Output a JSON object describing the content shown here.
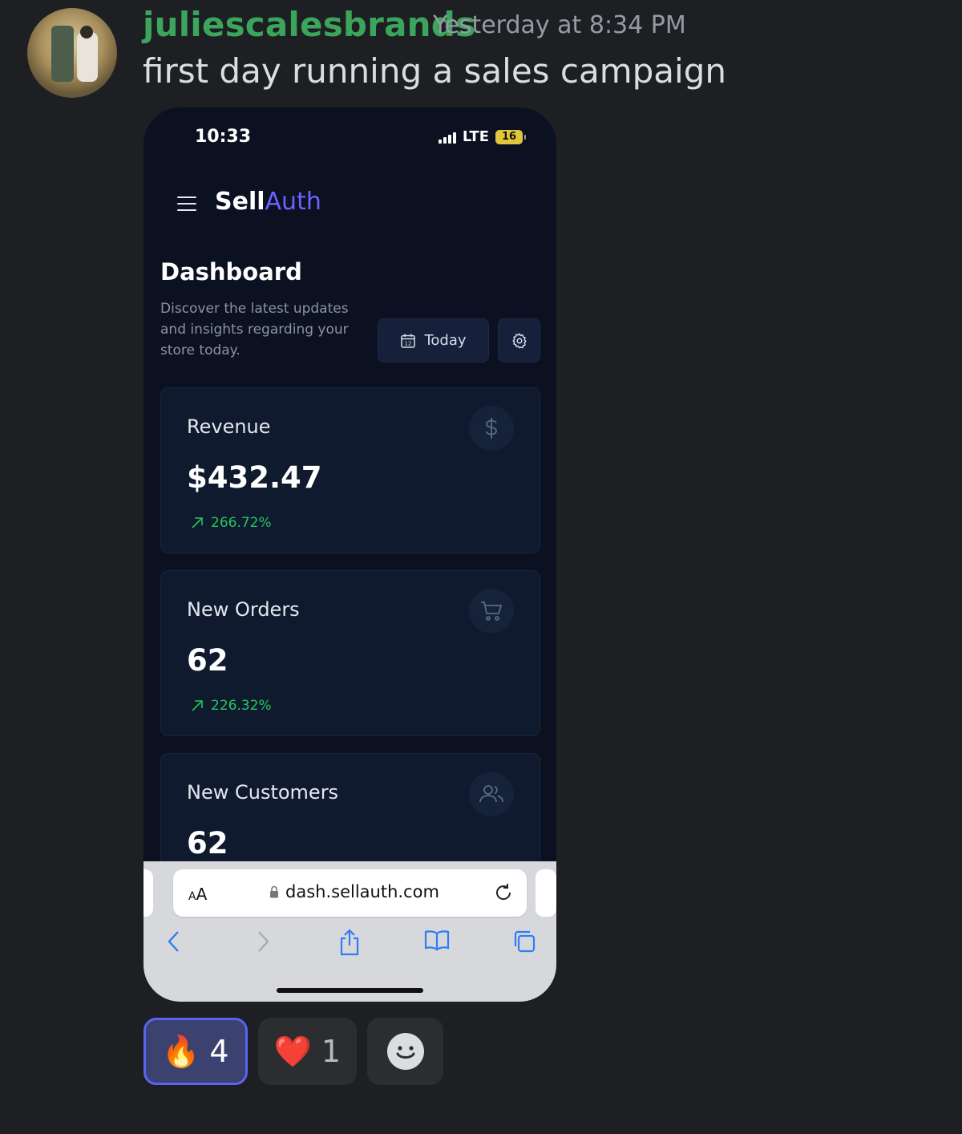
{
  "message": {
    "username": "juliescalesbrands",
    "timestamp": "Yesterday at 8:34 PM",
    "text": "first day running a sales campaign",
    "username_color": "#3ba55c"
  },
  "phone": {
    "status_bar": {
      "time": "10:33",
      "network": "LTE",
      "battery": "16"
    },
    "app": {
      "brand_primary": "Sell",
      "brand_accent": "Auth",
      "accent_color": "#6b63ff",
      "page_title": "Dashboard",
      "page_description": "Discover the latest updates and insights regarding your store today.",
      "date_filter_label": "Today"
    },
    "cards": [
      {
        "label": "Revenue",
        "value": "$432.47",
        "change": "266.72%",
        "icon": "dollar-icon"
      },
      {
        "label": "New Orders",
        "value": "62",
        "change": "226.32%",
        "icon": "cart-icon"
      },
      {
        "label": "New Customers",
        "value": "62",
        "icon": "users-icon"
      }
    ],
    "browser": {
      "text_size_label_big": "A",
      "text_size_label_small": "A",
      "url": "dash.sellauth.com"
    }
  },
  "reactions": [
    {
      "emoji": "🔥",
      "count": "4",
      "active": true
    },
    {
      "emoji": "❤️",
      "count": "1",
      "active": false
    }
  ]
}
